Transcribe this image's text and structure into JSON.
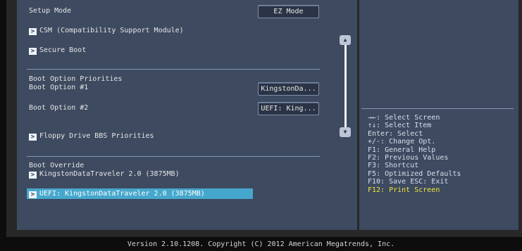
{
  "main": {
    "setup_mode": {
      "label": "Setup Mode",
      "value": "EZ Mode"
    },
    "csm": {
      "label": "CSM (Compatibility Support Module)"
    },
    "secure_boot": {
      "label": "Secure Boot"
    },
    "boot_option_priorities": {
      "heading": "Boot Option Priorities"
    },
    "boot_option_1": {
      "label": "Boot Option #1",
      "value": "KingstonDa..."
    },
    "boot_option_2": {
      "label": "Boot Option #2",
      "value": "UEFI: King..."
    },
    "floppy": {
      "label": "Floppy Drive BBS Priorities"
    },
    "boot_override": {
      "heading": "Boot Override",
      "items": [
        {
          "label": "KingstonDataTraveler 2.0  (3875MB)"
        },
        {
          "label": "UEFI: KingstonDataTraveler 2.0 (3875MB)"
        }
      ]
    },
    "arrow_icon": ">"
  },
  "scrollbar": {
    "up_icon": "▲",
    "down_icon": "▼"
  },
  "help": {
    "lines": [
      "→←: Select Screen",
      "↑↓: Select Item",
      "Enter: Select",
      "+/-: Change Opt.",
      "F1: General Help",
      "F2: Previous Values",
      "F3: Shortcut",
      "F5: Optimized Defaults",
      "F10: Save  ESC: Exit"
    ],
    "highlight_line": "F12: Print Screen"
  },
  "footer": {
    "version": "Version 2.10.1208. Copyright (C) 2012 American Megatrends, Inc."
  },
  "colors": {
    "panel": "#3d4a60",
    "selected": "#46a7cc",
    "highlight_text": "#f0e43a"
  }
}
